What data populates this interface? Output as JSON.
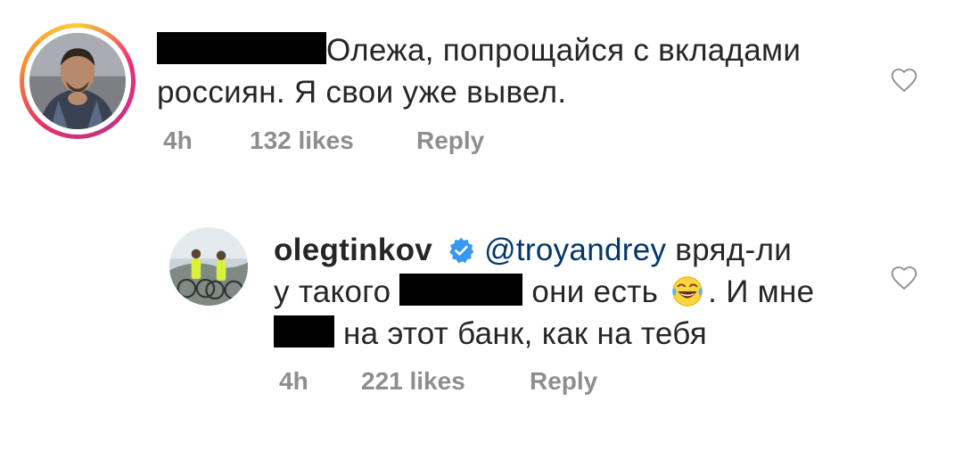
{
  "comments": [
    {
      "text_line1": "Олежа, попрощайся с вкладами",
      "text_line2": "россиян. Я свои уже вывел.",
      "time": "4h",
      "likes": "132 likes",
      "reply": "Reply"
    },
    {
      "username": "olegtinkov",
      "mention": "@troyandrey",
      "text_part1": " вряд-ли",
      "text_part2": "у такого ",
      "text_part3": " они есть ",
      "text_part4": ". И мне",
      "text_part5": " на этот банк, как на тебя",
      "time": "4h",
      "likes": "221 likes",
      "reply": "Reply"
    }
  ],
  "icons": {
    "verified": "verified-badge-icon",
    "like": "heart-outline-icon",
    "emoji": "tears-of-joy-emoji"
  },
  "colors": {
    "text": "#262626",
    "meta": "#8e8e8e",
    "mention": "#00376b",
    "verified": "#3897f0"
  }
}
